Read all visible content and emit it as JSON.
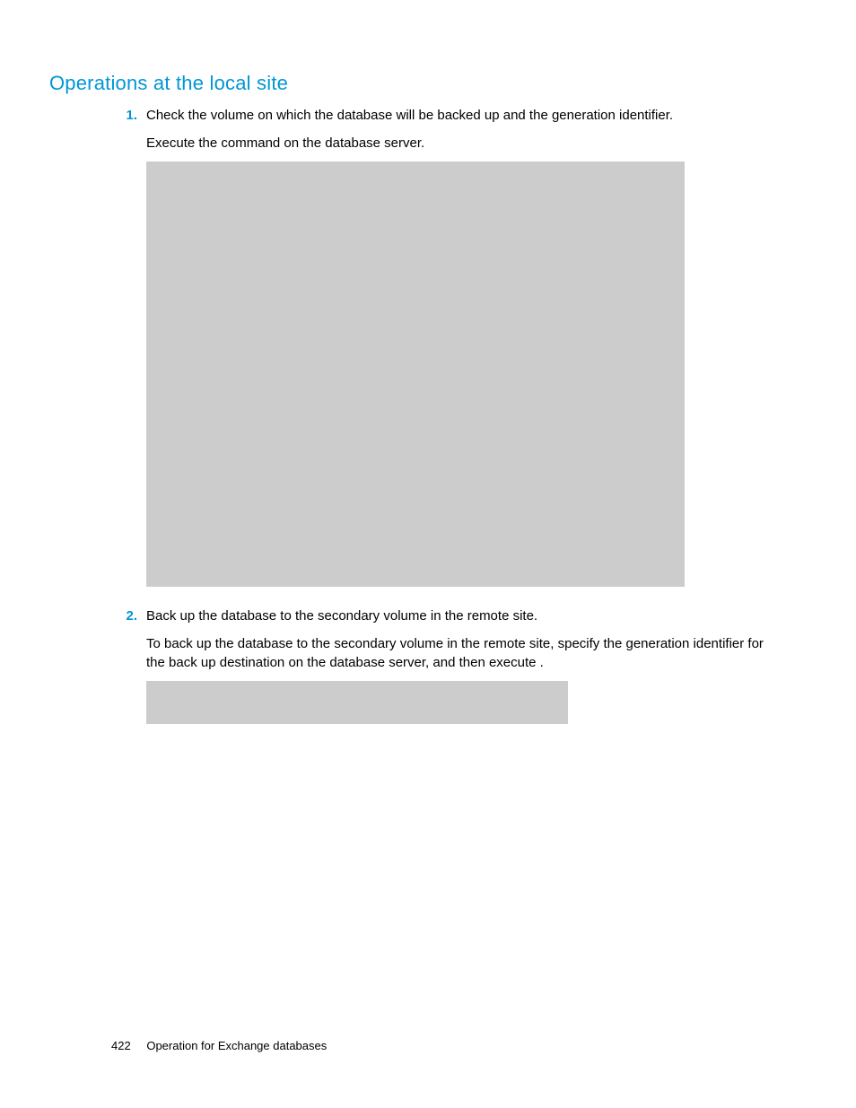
{
  "heading": "Operations at the local site",
  "items": [
    {
      "num": "1.",
      "line1": "Check the volume on which the database will be backed up and the generation identifier.",
      "line2_a": "Execute the ",
      "line2_b": " command on the database server."
    },
    {
      "num": "2.",
      "line1": "Back up the database to the secondary volume in the remote site.",
      "line2_a": "To back up the database to the secondary volume in the remote site, specify the generation identifier for the back up destination ",
      "line2_b": " on the database server, and then execute ",
      "line2_c": "."
    }
  ],
  "footer": {
    "page": "422",
    "title": "Operation for Exchange databases"
  }
}
